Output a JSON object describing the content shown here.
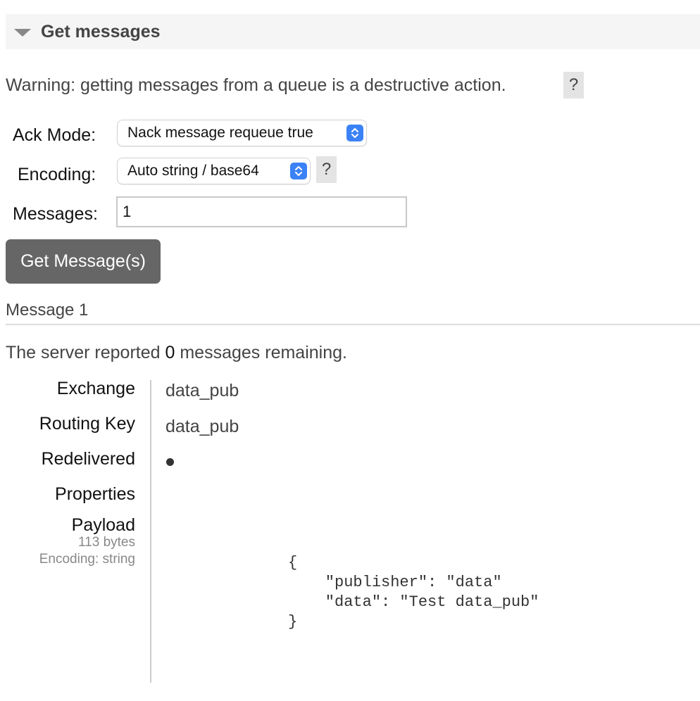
{
  "section": {
    "title": "Get messages"
  },
  "warning": {
    "text": "Warning: getting messages from a queue is a destructive action.",
    "help": "?"
  },
  "form": {
    "ack_mode": {
      "label": "Ack Mode:",
      "selected": "Nack message requeue true"
    },
    "encoding": {
      "label": "Encoding:",
      "selected": "Auto string / base64",
      "help": "?"
    },
    "messages": {
      "label": "Messages:",
      "value": "1"
    },
    "submit_label": "Get Message(s)"
  },
  "result": {
    "heading": "Message 1",
    "remaining_prefix": "The server reported ",
    "remaining_count": "0",
    "remaining_suffix": " messages remaining.",
    "fields": {
      "exchange_label": "Exchange",
      "exchange_value": "data_pub",
      "routing_key_label": "Routing Key",
      "routing_key_value": "data_pub",
      "redelivered_label": "Redelivered",
      "properties_label": "Properties",
      "payload_label": "Payload",
      "payload_size": "113 bytes",
      "payload_encoding": "Encoding: string",
      "payload_body": "{\n    \"publisher\": \"data\"\n    \"data\": \"Test data_pub\"\n}"
    }
  },
  "icons": {
    "collapse": "triangle-down-icon",
    "select_arrows": "up-down-chevron-icon",
    "redelivered": "bullet-icon"
  },
  "colors": {
    "button_bg": "#666666",
    "select_accent": "#3b82f6",
    "header_bg": "#f5f5f5"
  }
}
